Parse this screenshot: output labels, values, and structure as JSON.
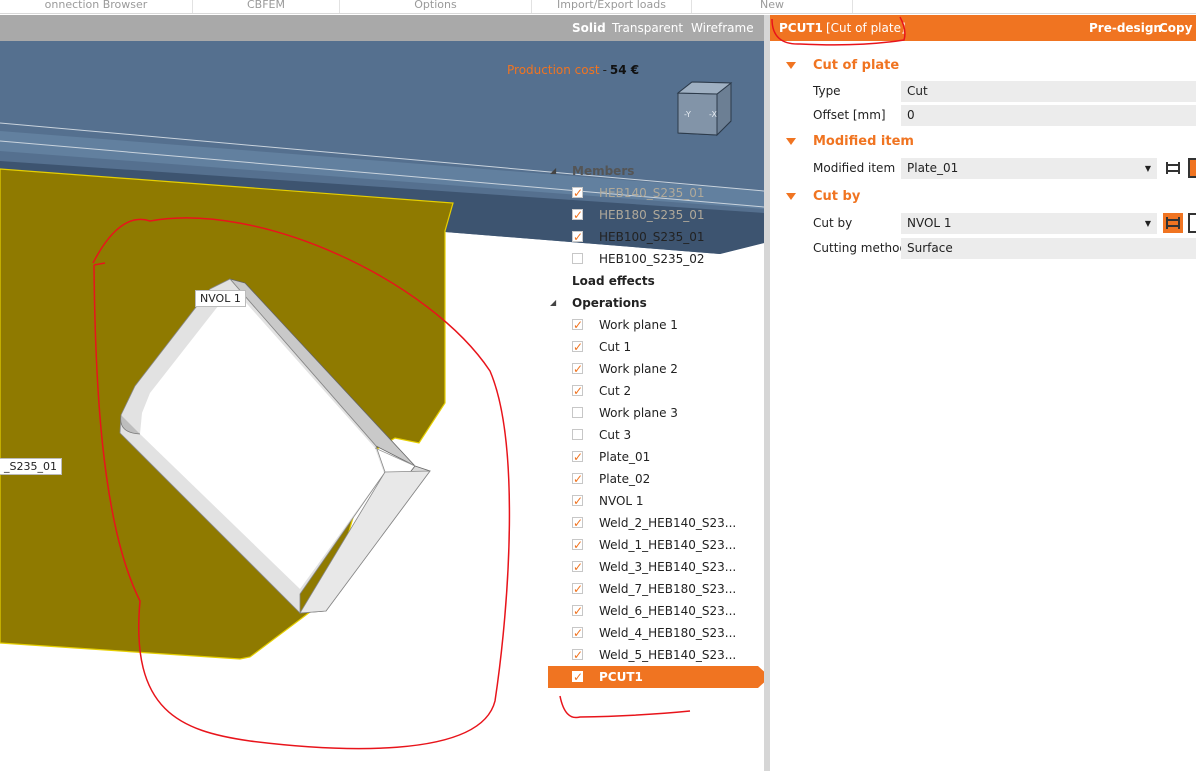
{
  "menu": {
    "items": [
      {
        "label": "onnection Browser",
        "width": 193
      },
      {
        "label": "CBFEM",
        "width": 147
      },
      {
        "label": "Options",
        "width": 192
      },
      {
        "label": "Import/Export loads",
        "width": 160
      },
      {
        "label": "New",
        "width": 161
      }
    ]
  },
  "view": {
    "modes": {
      "solid": "Solid",
      "transparent": "Transparent",
      "wireframe": "Wireframe"
    },
    "production_cost_label": "Production cost",
    "production_cost_sep": "-",
    "production_cost_value": "54 €",
    "cube_labels": {
      "left": "-Y",
      "right": "-X"
    },
    "labels": {
      "nvol": "NVOL 1",
      "member": "_S235_01"
    }
  },
  "tree": {
    "members_label": "Members",
    "members": [
      {
        "label": "HEB140_S235_01",
        "checked": true,
        "faded": true
      },
      {
        "label": "HEB180_S235_01",
        "checked": true,
        "faded": true
      },
      {
        "label": "HEB100_S235_01",
        "checked": true,
        "faded": false
      },
      {
        "label": "HEB100_S235_02",
        "checked": false,
        "faded": false
      }
    ],
    "load_effects_label": "Load effects",
    "operations_label": "Operations",
    "operations": [
      {
        "label": "Work plane 1",
        "checked": true
      },
      {
        "label": "Cut 1",
        "checked": true
      },
      {
        "label": "Work plane 2",
        "checked": true
      },
      {
        "label": "Cut 2",
        "checked": true
      },
      {
        "label": "Work plane 3",
        "checked": false
      },
      {
        "label": "Cut 3",
        "checked": false
      },
      {
        "label": "Plate_01",
        "checked": true
      },
      {
        "label": "Plate_02",
        "checked": true
      },
      {
        "label": "NVOL 1",
        "checked": true
      },
      {
        "label": "Weld_2_HEB140_S23...",
        "checked": true
      },
      {
        "label": "Weld_1_HEB140_S23...",
        "checked": true
      },
      {
        "label": "Weld_3_HEB140_S23...",
        "checked": true
      },
      {
        "label": "Weld_7_HEB180_S23...",
        "checked": true
      },
      {
        "label": "Weld_6_HEB140_S23...",
        "checked": true
      },
      {
        "label": "Weld_4_HEB180_S23...",
        "checked": true
      },
      {
        "label": "Weld_5_HEB140_S23...",
        "checked": true
      },
      {
        "label": "PCUT1",
        "checked": true,
        "selected": true
      }
    ]
  },
  "panel": {
    "title": "PCUT1",
    "subtitle": "[Cut of plate]",
    "predesign": "Pre-design",
    "copy": "Copy",
    "sections": {
      "cut_of_plate": "Cut of plate",
      "modified_item": "Modified item",
      "cut_by": "Cut by"
    },
    "fields": {
      "type_label": "Type",
      "type_value": "Cut",
      "offset_label": "Offset [mm]",
      "offset_value": "0",
      "modified_item_label": "Modified item",
      "modified_item_value": "Plate_01",
      "cut_by_label": "Cut by",
      "cut_by_value": "NVOL 1",
      "cutting_method_label": "Cutting method",
      "cutting_method_value": "Surface"
    }
  },
  "colors": {
    "accent": "#f07421",
    "toolbar": "#a9a9a9",
    "plate": "#8f7a00",
    "sky": "#55708f",
    "annotation": "#e8141b"
  }
}
